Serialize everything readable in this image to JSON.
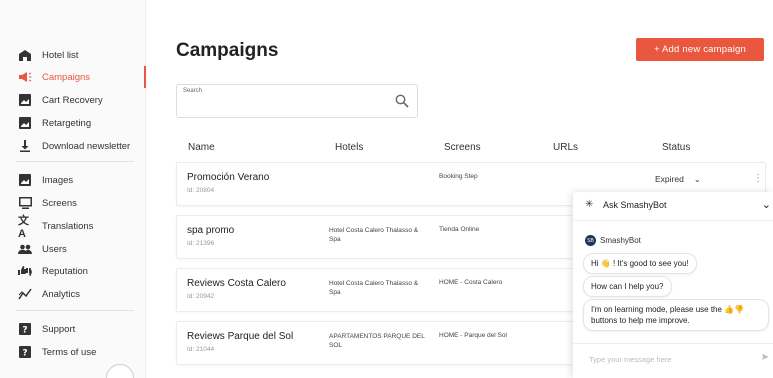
{
  "sidebar": {
    "items": [
      {
        "label": "Hotel list",
        "icon": "hotel-icon"
      },
      {
        "label": "Campaigns",
        "icon": "megaphone-icon",
        "active": true
      },
      {
        "label": "Cart Recovery",
        "icon": "cart-recovery-icon"
      },
      {
        "label": "Retargeting",
        "icon": "retargeting-icon"
      },
      {
        "label": "Download newsletter",
        "icon": "download-icon"
      },
      {
        "label": "Images",
        "icon": "image-icon"
      },
      {
        "label": "Screens",
        "icon": "monitor-icon"
      },
      {
        "label": "Translations",
        "icon": "translate-icon"
      },
      {
        "label": "Users",
        "icon": "users-icon"
      },
      {
        "label": "Reputation",
        "icon": "thumbs-icon"
      },
      {
        "label": "Analytics",
        "icon": "analytics-icon"
      },
      {
        "label": "Support",
        "icon": "help-icon"
      },
      {
        "label": "Terms of use",
        "icon": "help-icon"
      }
    ]
  },
  "header": {
    "title": "Campaigns",
    "add_button": "+ Add new campaign"
  },
  "search": {
    "label": "Search",
    "value": ""
  },
  "table": {
    "columns": [
      "Name",
      "Hotels",
      "Screens",
      "URLs",
      "Status"
    ],
    "rows": [
      {
        "name": "Promoción Verano",
        "id": "Id: 20804",
        "hotel": "",
        "screen": "Booking Step",
        "status": "Expired"
      },
      {
        "name": "spa promo",
        "id": "Id: 21396",
        "hotel": "Hotel Costa Calero Thalasso & Spa",
        "screen": "Tienda Online",
        "status": ""
      },
      {
        "name": "Reviews Costa Calero",
        "id": "Id: 20942",
        "hotel": "Hotel Costa Calero Thalasso & Spa",
        "screen": "HOME - Costa Calero",
        "status": ""
      },
      {
        "name": "Reviews Parque del Sol",
        "id": "Id: 21044",
        "hotel": "APARTAMENTOS PARQUE DEL SOL",
        "screen": "HOME - Parque del Sol",
        "status": ""
      }
    ]
  },
  "chat": {
    "title": "Ask SmashyBot",
    "bot_name": "SmashyBot",
    "avatar_text": "SB",
    "messages": [
      "Hi 👋 ! It's good to see you!",
      "How can I help you?",
      "I'm on learning mode, please use the 👍👎 buttons to help me improve."
    ],
    "input_placeholder": "Type your message here"
  },
  "colors": {
    "accent": "#e9573f",
    "text": "#333333"
  }
}
